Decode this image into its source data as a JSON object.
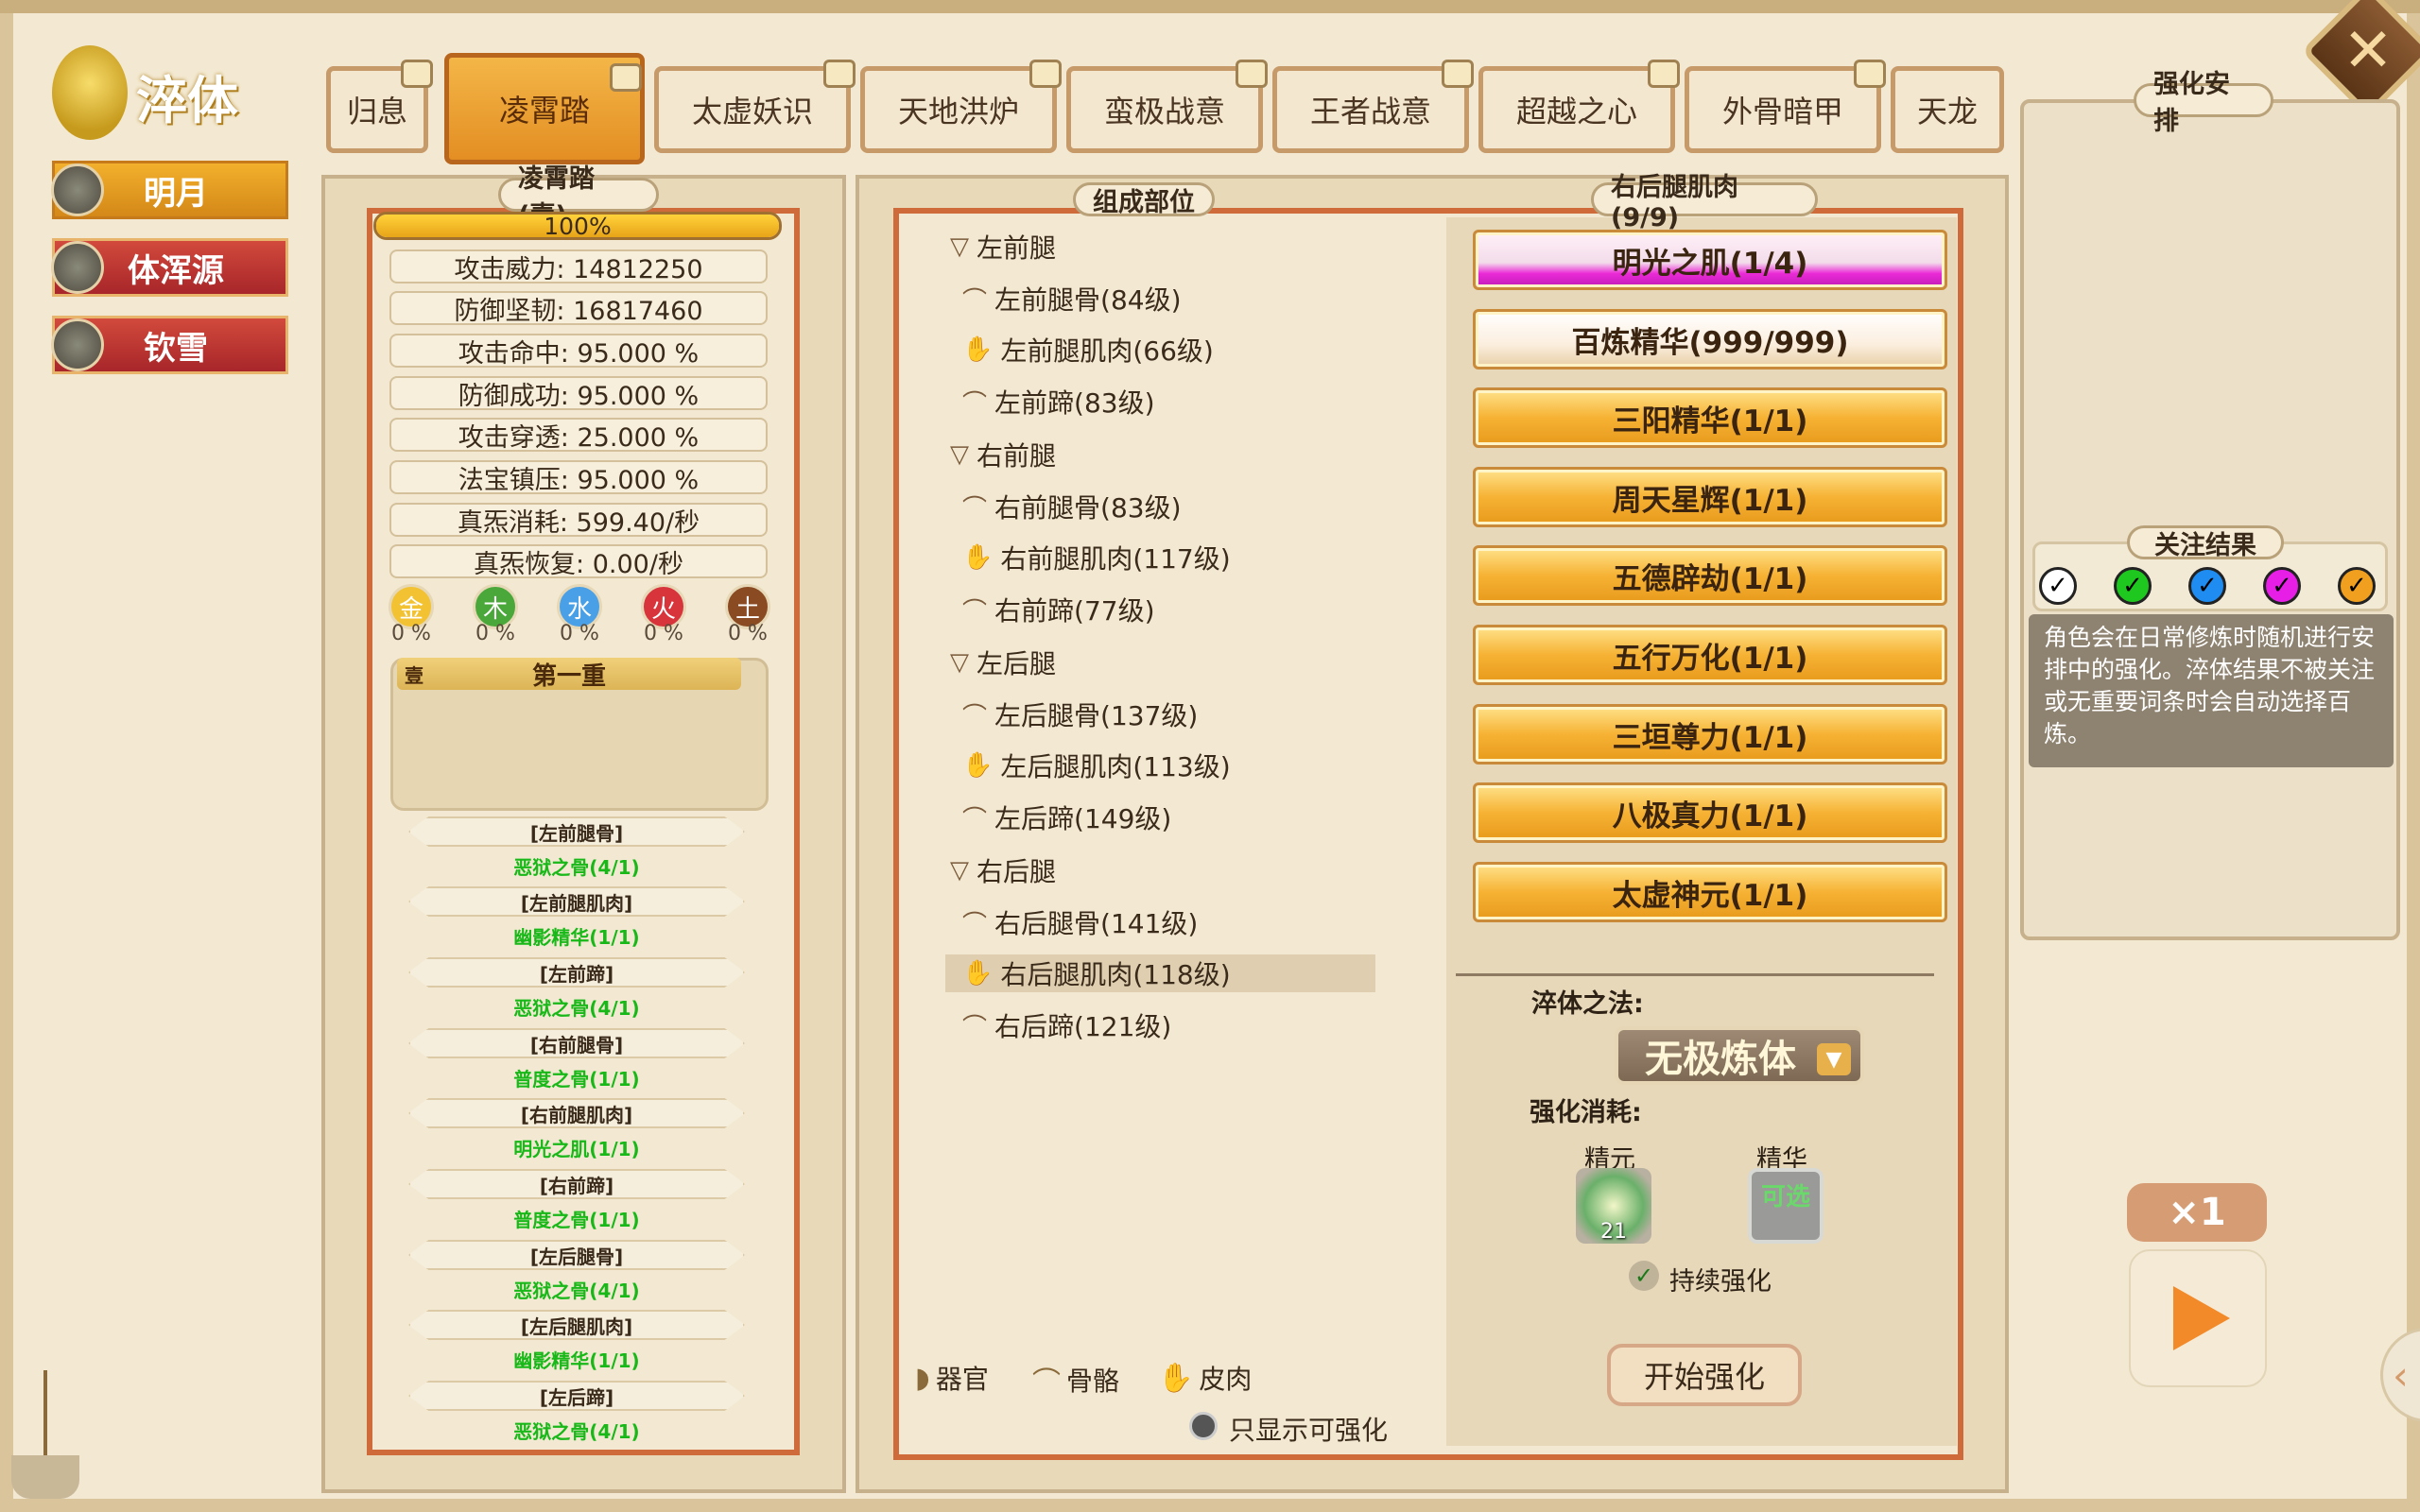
{
  "title": "淬体",
  "characters": [
    {
      "name": "明月",
      "active": true
    },
    {
      "name": "体浑源",
      "active": false
    },
    {
      "name": "钦雪",
      "active": false
    }
  ],
  "tabs": [
    "归息",
    "凌霄踏",
    "太虚妖识",
    "天地洪炉",
    "蛮极战意",
    "王者战意",
    "超越之心",
    "外骨暗甲",
    "天龙"
  ],
  "active_tab": "凌霄踏",
  "left_panel": {
    "title": "凌霄踏(壹)",
    "progress_text": "100%",
    "progress_value": 1.0,
    "stats": [
      "攻击威力: 14812250",
      "防御坚韧: 16817460",
      "攻击命中: 95.000 %",
      "防御成功: 95.000 %",
      "攻击穿透: 25.000 %",
      "法宝镇压: 95.000 %",
      "真炁消耗: 599.40/秒",
      "真炁恢复: 0.00/秒"
    ],
    "elements": [
      {
        "name": "金",
        "pct": "0 %",
        "color": "#f2c232"
      },
      {
        "name": "木",
        "pct": "0 %",
        "color": "#4aa83a"
      },
      {
        "name": "水",
        "pct": "0 %",
        "color": "#4aa0e6"
      },
      {
        "name": "火",
        "pct": "0 %",
        "color": "#d8343c"
      },
      {
        "name": "土",
        "pct": "0 %",
        "color": "#8a4a22"
      }
    ],
    "layer_badge": "壹",
    "layer_title": "第一重",
    "requirements": [
      {
        "part": "[左前腿骨]",
        "value": "恶狱之骨(4/1)"
      },
      {
        "part": "[左前腿肌肉]",
        "value": "幽影精华(1/1)"
      },
      {
        "part": "[左前蹄]",
        "value": "恶狱之骨(4/1)"
      },
      {
        "part": "[右前腿骨]",
        "value": "普度之骨(1/1)"
      },
      {
        "part": "[右前腿肌肉]",
        "value": "明光之肌(1/1)"
      },
      {
        "part": "[右前蹄]",
        "value": "普度之骨(1/1)"
      },
      {
        "part": "[左后腿骨]",
        "value": "恶狱之骨(4/1)"
      },
      {
        "part": "[左后腿肌肉]",
        "value": "幽影精华(1/1)"
      },
      {
        "part": "[左后蹄]",
        "value": "恶狱之骨(4/1)"
      }
    ]
  },
  "mid_panel": {
    "title": "组成部位",
    "groups": [
      {
        "name": "左前腿",
        "items": [
          {
            "icon": "bone",
            "label": "左前腿骨(84级)"
          },
          {
            "icon": "muscle",
            "label": "左前腿肌肉(66级)"
          },
          {
            "icon": "bone",
            "label": "左前蹄(83级)"
          }
        ]
      },
      {
        "name": "右前腿",
        "items": [
          {
            "icon": "bone",
            "label": "右前腿骨(83级)"
          },
          {
            "icon": "muscle",
            "label": "右前腿肌肉(117级)"
          },
          {
            "icon": "bone",
            "label": "右前蹄(77级)"
          }
        ]
      },
      {
        "name": "左后腿",
        "items": [
          {
            "icon": "bone",
            "label": "左后腿骨(137级)"
          },
          {
            "icon": "muscle",
            "label": "左后腿肌肉(113级)"
          },
          {
            "icon": "bone",
            "label": "左后蹄(149级)"
          }
        ]
      },
      {
        "name": "右后腿",
        "items": [
          {
            "icon": "bone",
            "label": "右后腿骨(141级)"
          },
          {
            "icon": "muscle",
            "label": "右后腿肌肉(118级)",
            "selected": true
          },
          {
            "icon": "bone",
            "label": "右后蹄(121级)"
          }
        ]
      }
    ],
    "legend": [
      "器官",
      "骨骼",
      "皮肉"
    ],
    "filter_label": "只显示可强化"
  },
  "materials_panel": {
    "title": "右后腿肌肉(9/9)",
    "materials": [
      "明光之肌(1/4)",
      "百炼精华(999/999)",
      "三阳精华(1/1)",
      "周天星辉(1/1)",
      "五德辟劫(1/1)",
      "五行万化(1/1)",
      "三垣尊力(1/1)",
      "八极真力(1/1)",
      "太虚神元(1/1)"
    ],
    "method_label": "淬体之法:",
    "method_value": "无极炼体",
    "cost_label": "强化消耗:",
    "cost_items": [
      {
        "label": "精元",
        "count": "21"
      },
      {
        "label": "精华",
        "overlay": "可选"
      }
    ],
    "continuous_label": "持续强化",
    "start_button": "开始强化"
  },
  "right_panel": {
    "title": "强化安排",
    "focus_title": "关注结果",
    "focus_colors": [
      "#ffffff",
      "#1ec81e",
      "#1e8cf0",
      "#e61ee6",
      "#f0a01e"
    ],
    "description": "角色会在日常修炼时随机进行安排中的强化。淬体结果不被关注或无重要词条时会自动选择百炼。",
    "multiplier": "×1"
  }
}
